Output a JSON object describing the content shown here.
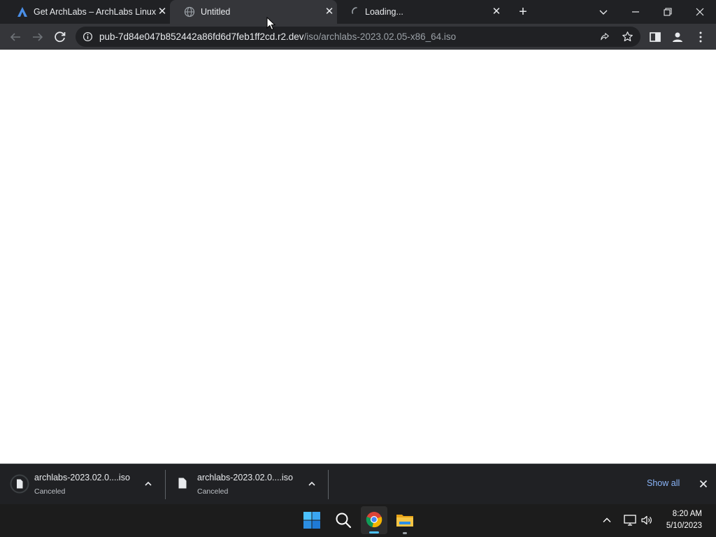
{
  "tabs": [
    {
      "title": "Get ArchLabs – ArchLabs Linux",
      "icon": "archlabs-logo-icon"
    },
    {
      "title": "Untitled",
      "icon": "globe-icon",
      "active": true
    },
    {
      "title": "Loading...",
      "icon": "loading-spinner-icon"
    }
  ],
  "tab_close_glyph": "✕",
  "new_tab_glyph": "+",
  "address": {
    "host": "pub-7d84e047b852442a86fd6d7feb1ff2cd.r2.dev",
    "path": "/iso/archlabs-2023.02.05-x86_64.iso"
  },
  "downloads": [
    {
      "name": "archlabs-2023.02.0....iso",
      "status": "Canceled"
    },
    {
      "name": "archlabs-2023.02.0....iso",
      "status": "Canceled"
    }
  ],
  "download_bar": {
    "show_all": "Show all"
  },
  "taskbar": {
    "time": "8:20 AM",
    "date": "5/10/2023"
  },
  "colors": {
    "chrome_dark": "#202124",
    "toolbar": "#35363a",
    "link": "#8ab4f8",
    "taskbar": "#1c1c1c"
  }
}
